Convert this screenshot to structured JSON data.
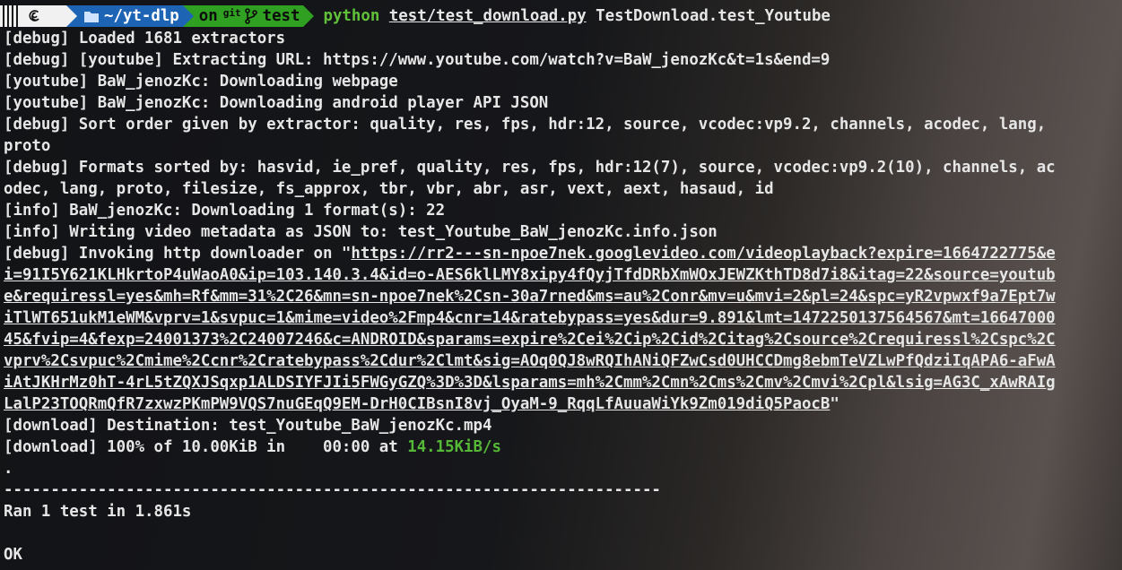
{
  "prompt": {
    "os_icon": "debian-swirl-icon",
    "dir": "~/yt-dlp",
    "git_on": "on",
    "git_label": "git",
    "branch": "test",
    "command": "python",
    "test_file": "test/test_download.py",
    "test_name": "TestDownload.test_Youtube",
    "colors": {
      "dir_bg": "#1e64b4",
      "git_bg": "#30a022",
      "os_bg": "#f1f1f1",
      "python": "#61c23a"
    }
  },
  "output": {
    "l1": "[debug] Loaded 1681 extractors",
    "l2": "[debug] [youtube] Extracting URL: https://www.youtube.com/watch?v=BaW_jenozKc&t=1s&end=9",
    "l3": "[youtube] BaW_jenozKc: Downloading webpage",
    "l4": "[youtube] BaW_jenozKc: Downloading android player API JSON",
    "l5": "[debug] Sort order given by extractor: quality, res, fps, hdr:12, source, vcodec:vp9.2, channels, acodec, lang,",
    "l6": "proto",
    "l7": "[debug] Formats sorted by: hasvid, ie_pref, quality, res, fps, hdr:12(7), source, vcodec:vp9.2(10), channels, ac",
    "l8": "odec, lang, proto, filesize, fs_approx, tbr, vbr, abr, asr, vext, aext, hasaud, id",
    "l9": "[info] BaW_jenozKc: Downloading 1 format(s): 22",
    "l10": "[info] Writing video metadata as JSON to: test_Youtube_BaW_jenozKc.info.json",
    "l11_prefix": "[debug] Invoking http downloader on \"",
    "url1": "https://rr2---sn-npoe7nek.googlevideo.com/videoplayback?expire=1664722775&e",
    "url2": "i=91I5Y621KLHkrtoP4uWaoA0&ip=103.140.3.4&id=o-AES6klLMY8xipy4fQyjTfdDRbXmWOxJEWZKthTD8d7i8&itag=22&source=youtub",
    "url3": "e&requiressl=yes&mh=Rf&mm=31%2C26&mn=sn-npoe7nek%2Csn-30a7rned&ms=au%2Conr&mv=u&mvi=2&pl=24&spc=yR2vpwxf9a7Ept7w",
    "url4": "iTlWT651ukM1eWM&vprv=1&svpuc=1&mime=video%2Fmp4&cnr=14&ratebypass=yes&dur=9.891&lmt=1472250137564567&mt=16647000",
    "url5": "45&fvip=4&fexp=24001373%2C24007246&c=ANDROID&sparams=expire%2Cei%2Cip%2Cid%2Citag%2Csource%2Crequiressl%2Cspc%2C",
    "url6": "vprv%2Csvpuc%2Cmime%2Ccnr%2Cratebypass%2Cdur%2Clmt&sig=AOq0QJ8wRQIhANiQFZwCsd0UHCCDmg8ebmTeVZLwPfQdziIqAPA6-aFwA",
    "url7": "iAtJKHrMz0hT-4rL5tZQXJSqxp1ALDSIYFJIi5FWGyGZQ%3D%3D&lsparams=mh%2Cmm%2Cmn%2Cms%2Cmv%2Cmvi%2Cpl&lsig=AG3C_xAwRAIg",
    "url8": "LalP23TOQRmQfR7zxwzPKmPW9VQS7nuGEqQ9EM-DrH0CIBsnI8vj_OyaM-9_RqqLfAuuaWiYk9Zm019diQ5PaocB",
    "url_suffix": "\"",
    "l19": "[download] Destination: test_Youtube_BaW_jenozKc.mp4",
    "l20_prefix": "[download] 100% of 10.00KiB in    00:00 at ",
    "l20_speed": "14.15KiB/s",
    "dot": ".",
    "rule": "----------------------------------------------------------------------",
    "ran": "Ran 1 test in 1.861s",
    "ok": "OK",
    "speed_color": "#55b836"
  }
}
